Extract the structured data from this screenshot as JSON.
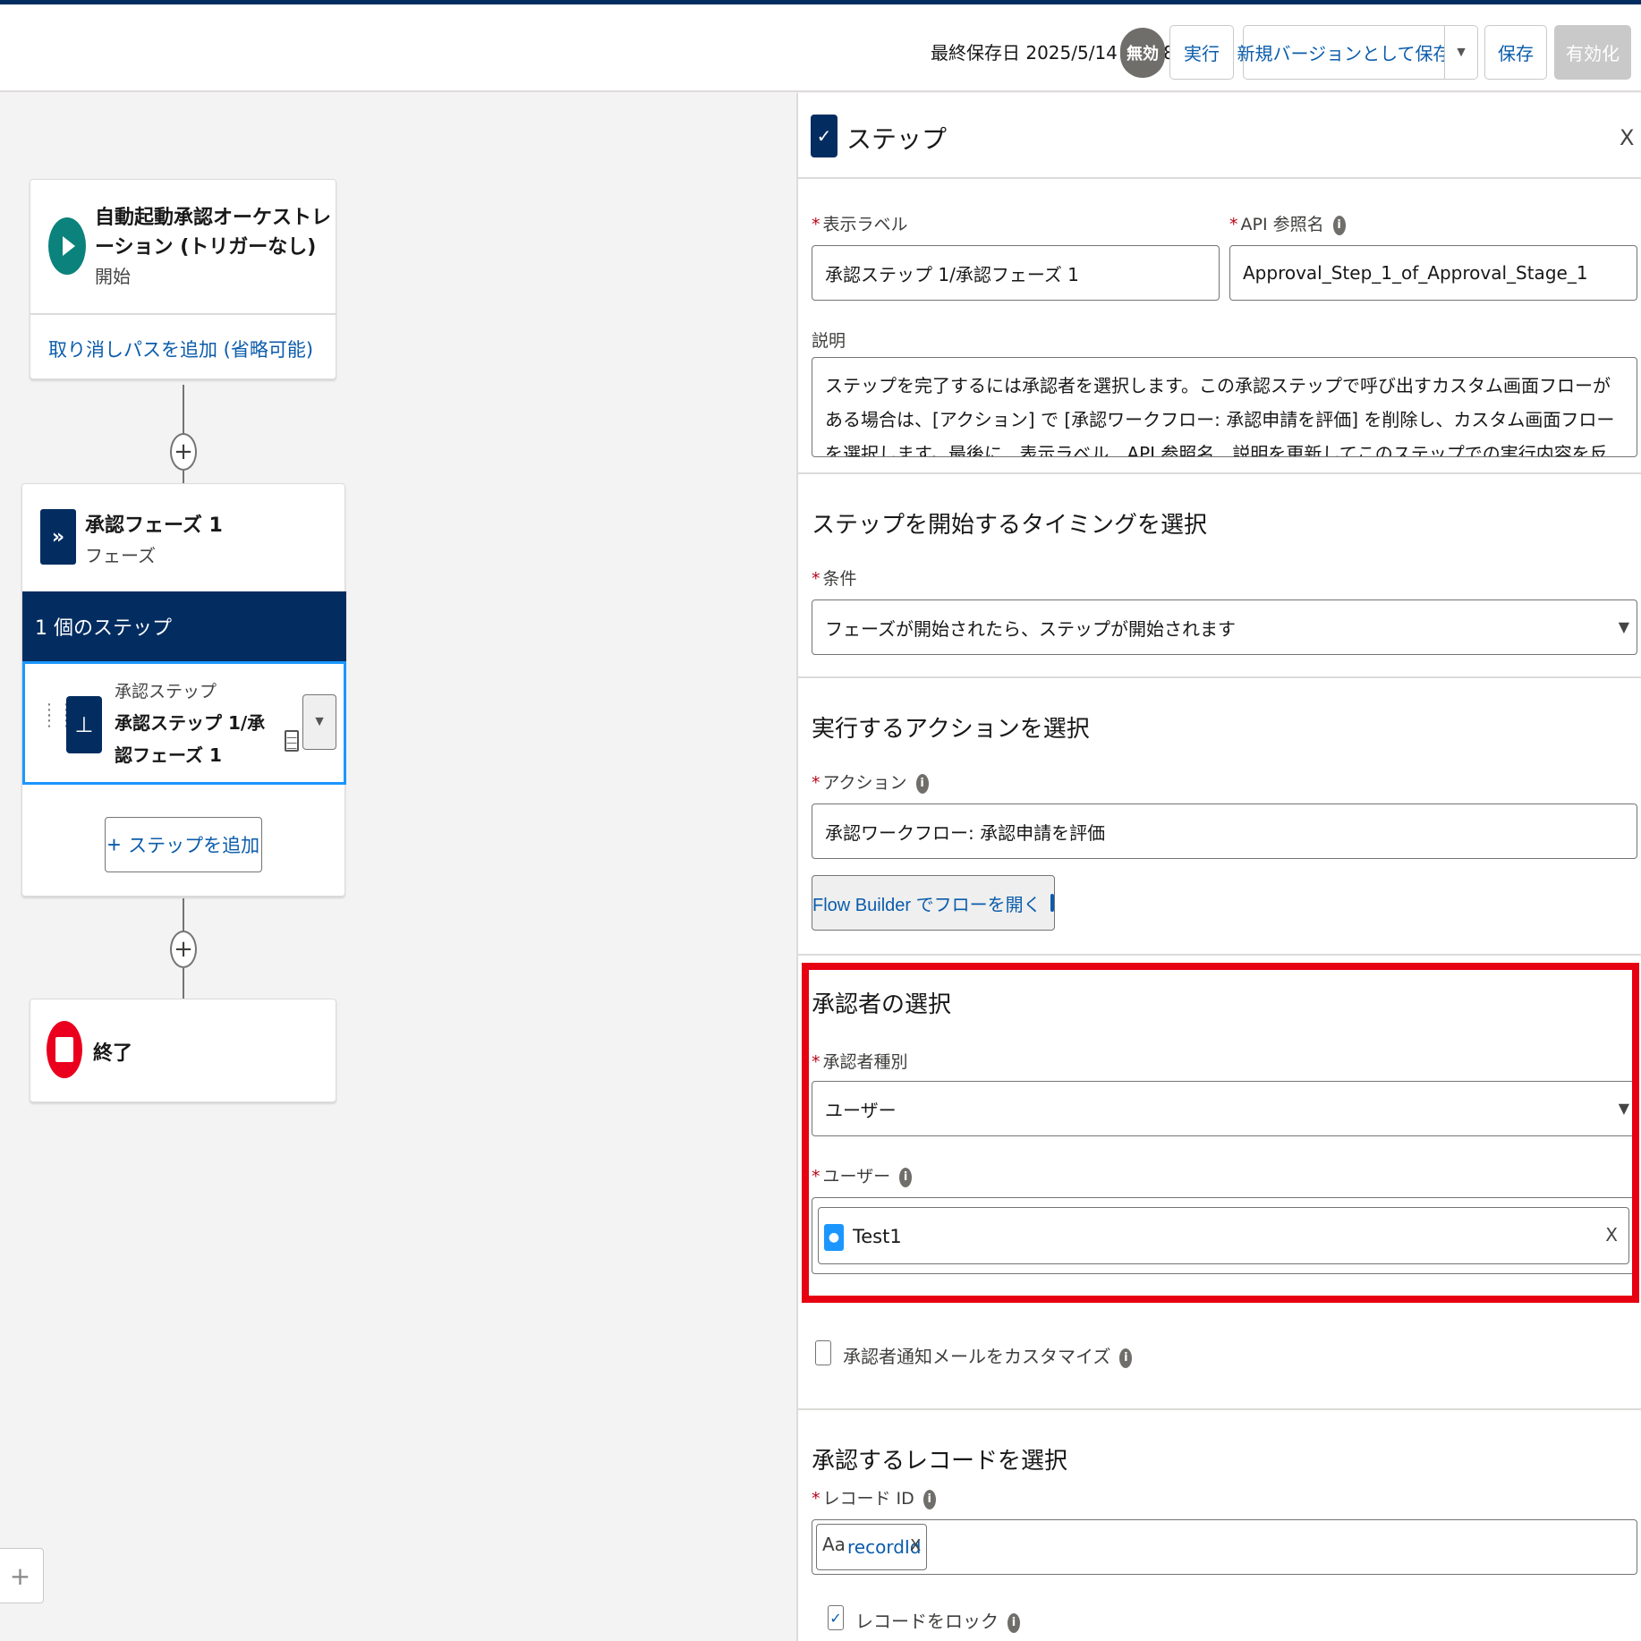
{
  "colors": {
    "brand_navy": "#032d60",
    "link_blue": "#0b5cab",
    "highlight_red": "#e60012",
    "start_green": "#0b827c",
    "end_red": "#ea001e",
    "user_blue": "#1b96ff"
  },
  "header": {
    "last_saved": "最終保存日 2025/5/14 00:28",
    "status_badge": "無効",
    "run_label": "実行",
    "save_as_new_version_label": "新規バージョンとして保存",
    "save_label": "保存",
    "activate_label": "有効化"
  },
  "canvas": {
    "start_node": {
      "title": "自動起動承認オーケストレーション (トリガーなし)",
      "subtitle": "開始",
      "add_cancel_path_link": "取り消しパスを追加 (省略可能)"
    },
    "phase_node": {
      "icon": "chevron-double-icon",
      "title": "承認フェーズ 1",
      "subtitle": "フェーズ",
      "step_count": "1 個のステップ",
      "step": {
        "icon": "stamp-icon",
        "type": "承認ステップ",
        "name": "承認ステップ 1/承認フェーズ 1"
      },
      "add_step_label": "ステップを追加"
    },
    "end_node": {
      "label": "終了"
    }
  },
  "panel": {
    "title": "ステップ",
    "close": "X",
    "display_label": {
      "label": "表示ラベル",
      "value": "承認ステップ 1/承認フェーズ 1"
    },
    "api_name": {
      "label": "API 参照名",
      "value": "Approval_Step_1_of_Approval_Stage_1"
    },
    "description": {
      "label": "説明",
      "value": "ステップを完了するには承認者を選択します。この承認ステップで呼び出すカスタム画面フローがある場合は、[アクション] で [承認ワークフロー: 承認申請を評価] を削除し、カスタム画面フローを選択します。最後に、表示ラベル、API 参照名、説明を更新してこのステップでの実行内容を反映させます。"
    },
    "timing_section": {
      "title": "ステップを開始するタイミングを選択",
      "condition_label": "条件",
      "condition_value": "フェーズが開始されたら、ステップが開始されます"
    },
    "action_section": {
      "title": "実行するアクションを選択",
      "action_label": "アクション",
      "action_value": "承認ワークフロー: 承認申請を評価",
      "open_flow_builder_label": "Flow Builder でフローを開く"
    },
    "approver_section": {
      "title": "承認者の選択",
      "approver_type_label": "承認者種別",
      "approver_type_value": "ユーザー",
      "user_label": "ユーザー",
      "user_value": "Test1"
    },
    "customize_email_label": "承認者通知メールをカスタマイズ",
    "record_section": {
      "title": "承認するレコードを選択",
      "record_id_label": "レコード ID",
      "record_id_value": "recordId",
      "lock_record_label": "レコードをロック"
    }
  }
}
